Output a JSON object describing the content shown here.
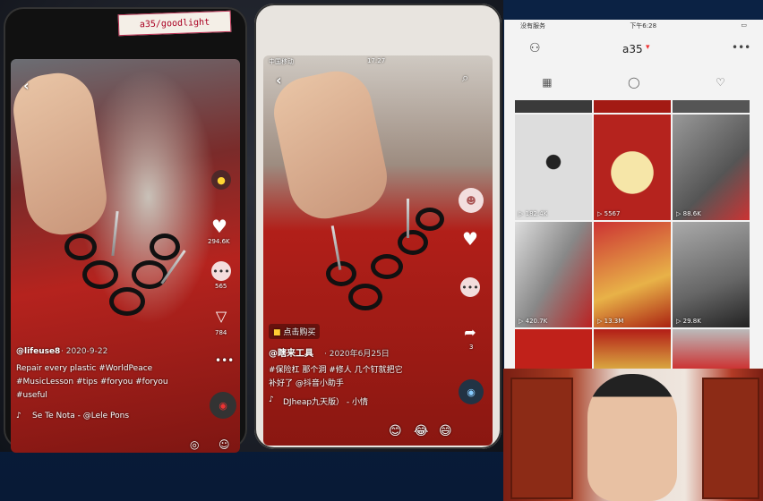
{
  "left_phone": {
    "label": "a35/goodlight",
    "username": "@lifeuse8",
    "date": "· 2020-9-22",
    "caption_1": "Repair every plastic #WorldPeace",
    "caption_2": "#MusicLesson #tips #foryou #foryou",
    "caption_3": "#useful",
    "music": "Se Te Nota - @Lele Pons",
    "likes": "294.6K",
    "comments": "565",
    "shares": "784"
  },
  "middle_phone": {
    "status_carrier": "中国移动",
    "status_time": "17:27",
    "shop_tag": "点击购买",
    "username": "@瞎来工具",
    "date": "· 2020年6月25日",
    "caption_1": "#保险杠 那个洞 #修人 几个钉就把它",
    "caption_2": "补好了 @抖音小助手",
    "music": "DJheap九天版） - 小情",
    "share_count": "3"
  },
  "right_phone": {
    "status_carrier": "没有服务",
    "status_time": "下午6:28",
    "username": "a35",
    "grid": [
      {
        "views": "182.4K"
      },
      {
        "views": "5567"
      },
      {
        "views": "88.6K"
      },
      {
        "views": "420.7K"
      },
      {
        "views": "13.3M"
      },
      {
        "views": "29.8K"
      }
    ]
  }
}
